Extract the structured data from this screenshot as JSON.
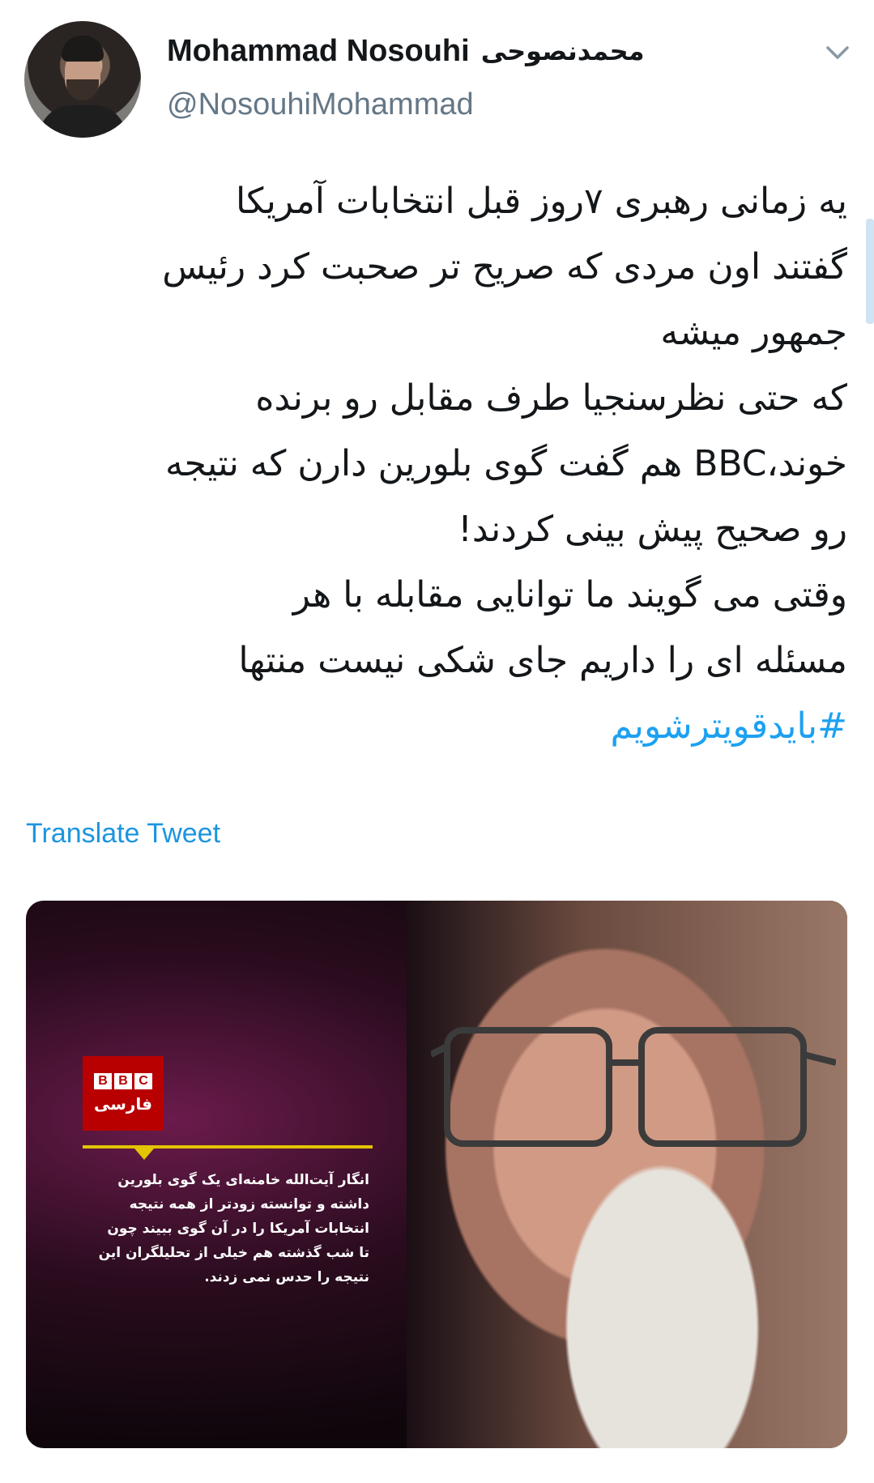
{
  "author": {
    "name": "Mohammad Nosouhi",
    "name_fa": "محمدنصوحی",
    "handle": "@NosouhiMohammad"
  },
  "tweet": {
    "lines": [
      "یه زمانی رهبری ۷روز قبل انتخابات آمریکا",
      "گفتند اون مردی که صریح تر صحبت کرد رئیس",
      "جمهور میشه",
      "که حتی نظرسنجیا طرف مقابل رو برنده",
      "خوند،BBC هم گفت گوی بلورین دارن که نتیجه",
      "رو صحیح پیش بینی کردند!",
      "وقتی می گویند ما توانایی مقابله با هر",
      "مسئله ای را داریم جای شکی نیست منتها"
    ],
    "hashtag": "#بایدقویترشویم",
    "translate_label": "Translate Tweet"
  },
  "media": {
    "bbc_logo": "BBC",
    "bbc_label": "فارسی",
    "caption_lines": [
      "انگار آیت‌الله خامنه‌ای یک گوی بلورین",
      "داشته و توانسته زودتر از همه نتیجه",
      "انتخابات آمریکا را در آن گوی ببیند چون",
      "تا شب گذشته هم خیلی از تحلیلگران این",
      "نتیجه را حدس نمی زدند."
    ]
  },
  "colors": {
    "text": "#14171a",
    "secondary": "#657786",
    "link": "#1da1f2",
    "bbc_red": "#b80000",
    "bbc_yellow": "#e2c400"
  },
  "icons": [
    "chevron-down-icon"
  ]
}
